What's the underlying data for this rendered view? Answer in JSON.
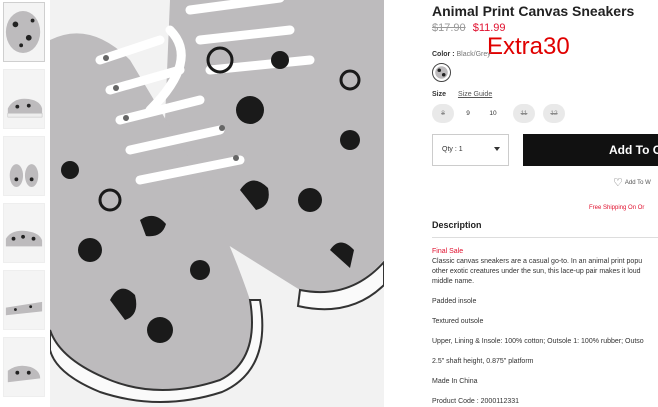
{
  "product": {
    "title": "Animal Print Canvas Sneakers",
    "price_old": "$17.90",
    "price_new": "$11.99",
    "promo_code": "Extra30"
  },
  "color": {
    "label": "Color :",
    "value": "Black/Grey"
  },
  "size": {
    "label": "Size",
    "guide_label": "Size Guide",
    "options": [
      {
        "label": "8",
        "available": false
      },
      {
        "label": "9",
        "available": true
      },
      {
        "label": "10",
        "available": true
      },
      {
        "label": "11",
        "available": false
      },
      {
        "label": "12",
        "available": false
      }
    ]
  },
  "purchase": {
    "qty_label": "Qty : 1",
    "add_to_cart_label": "Add To C",
    "wishlist_label": "Add To W",
    "shipping_label": "Free Shipping On Or"
  },
  "description": {
    "heading": "Description",
    "sale_label": "Final Sale",
    "lines": [
      "Classic canvas sneakers are a casual go-to. In an animal print popu",
      "other exotic creatures under the sun, this lace-up pair makes it loud",
      "middle name."
    ],
    "details": [
      "Padded insole",
      "Textured outsole",
      "Upper, Lining & Insole: 100% cotton; Outsole 1: 100% rubber; Outso",
      "2.5\" shaft height, 0.875\" platform",
      "Made In China",
      "Product Code : 2000112331"
    ]
  },
  "colors": {
    "price_sale": "#e0102e",
    "promo": "#e00000",
    "button_bg": "#111111",
    "canvas_grey": "#bdbbbd"
  }
}
